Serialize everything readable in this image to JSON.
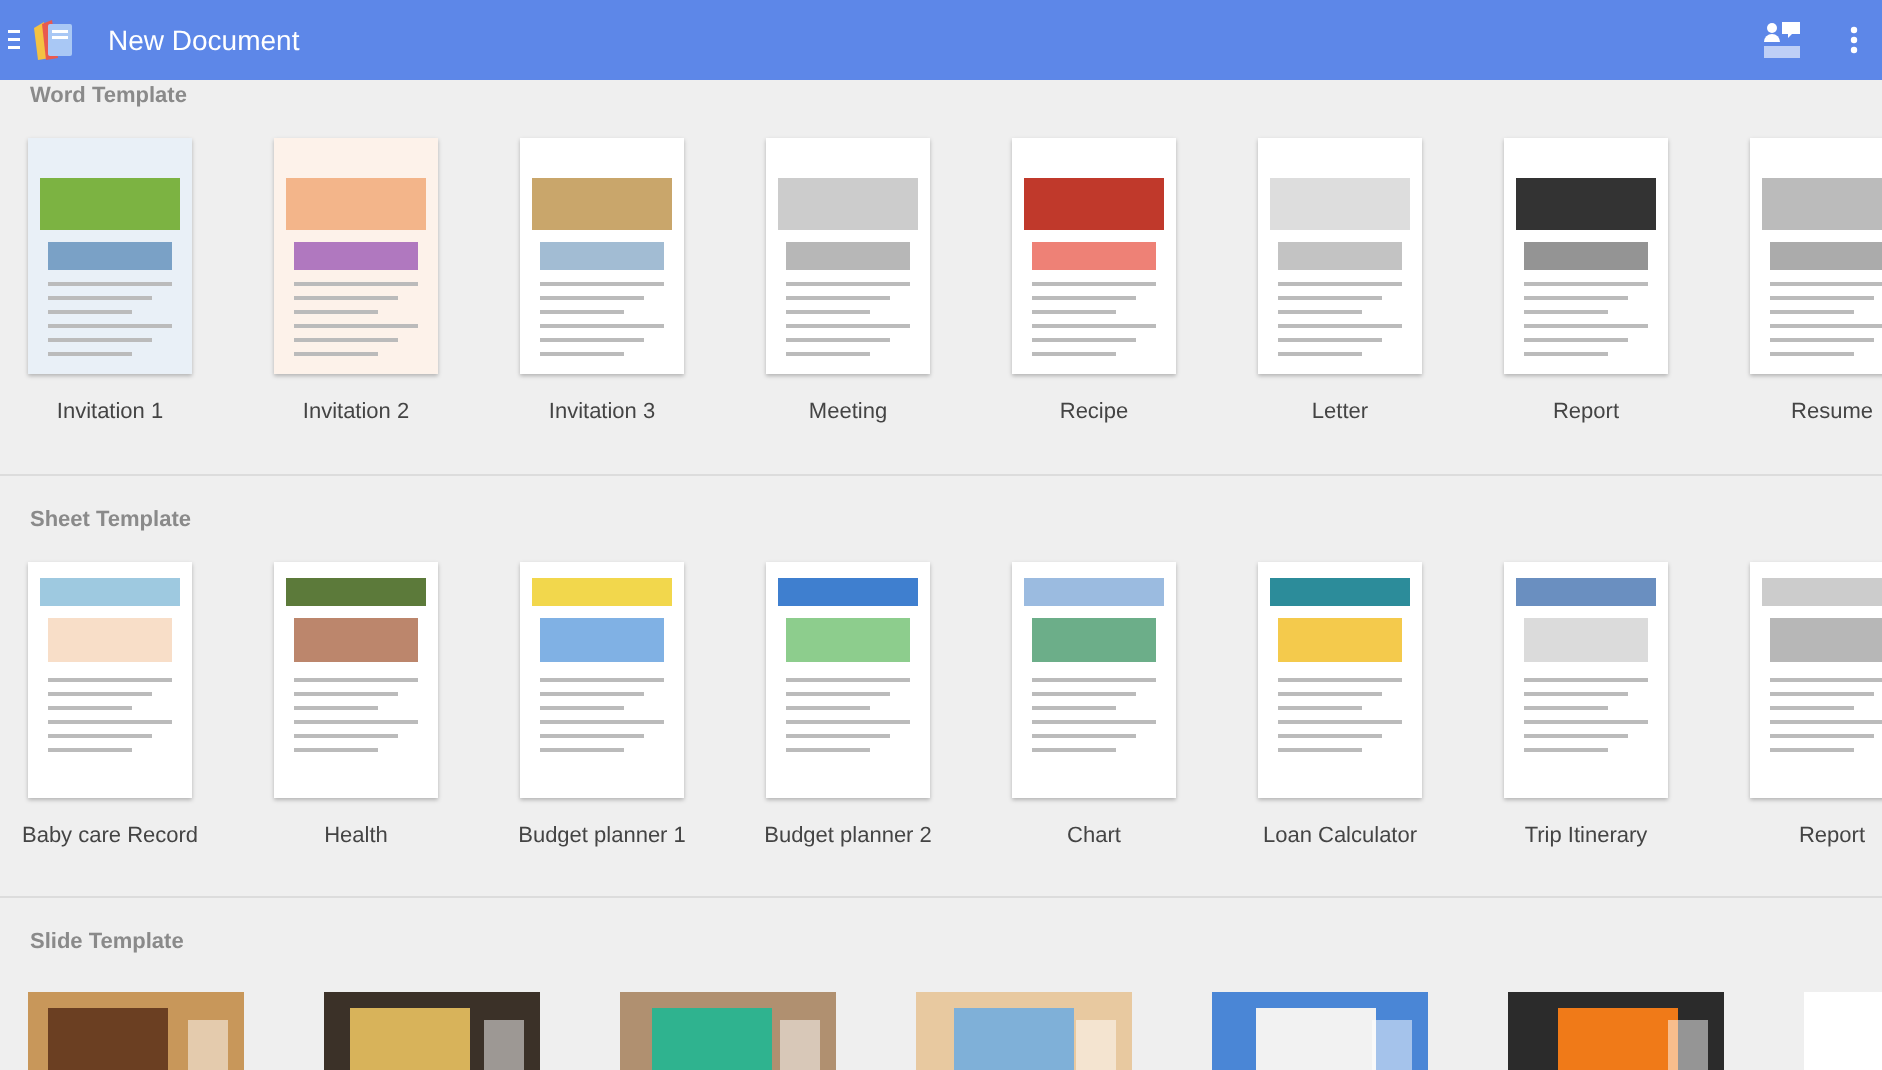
{
  "app_bar": {
    "title": "New Document"
  },
  "sections": [
    {
      "title": "Word Template",
      "kind": "document",
      "templates": [
        {
          "name": "Invitation 1"
        },
        {
          "name": "Invitation 2"
        },
        {
          "name": "Invitation 3"
        },
        {
          "name": "Meeting"
        },
        {
          "name": "Recipe"
        },
        {
          "name": "Letter"
        },
        {
          "name": "Report"
        },
        {
          "name": "Resume"
        }
      ]
    },
    {
      "title": "Sheet Template",
      "kind": "document",
      "templates": [
        {
          "name": "Baby care Record"
        },
        {
          "name": "Health"
        },
        {
          "name": "Budget planner 1"
        },
        {
          "name": "Budget planner 2"
        },
        {
          "name": "Chart"
        },
        {
          "name": "Loan Calculator"
        },
        {
          "name": "Trip Itinerary"
        },
        {
          "name": "Report"
        }
      ]
    },
    {
      "title": "Slide Template",
      "kind": "slide"
    }
  ]
}
